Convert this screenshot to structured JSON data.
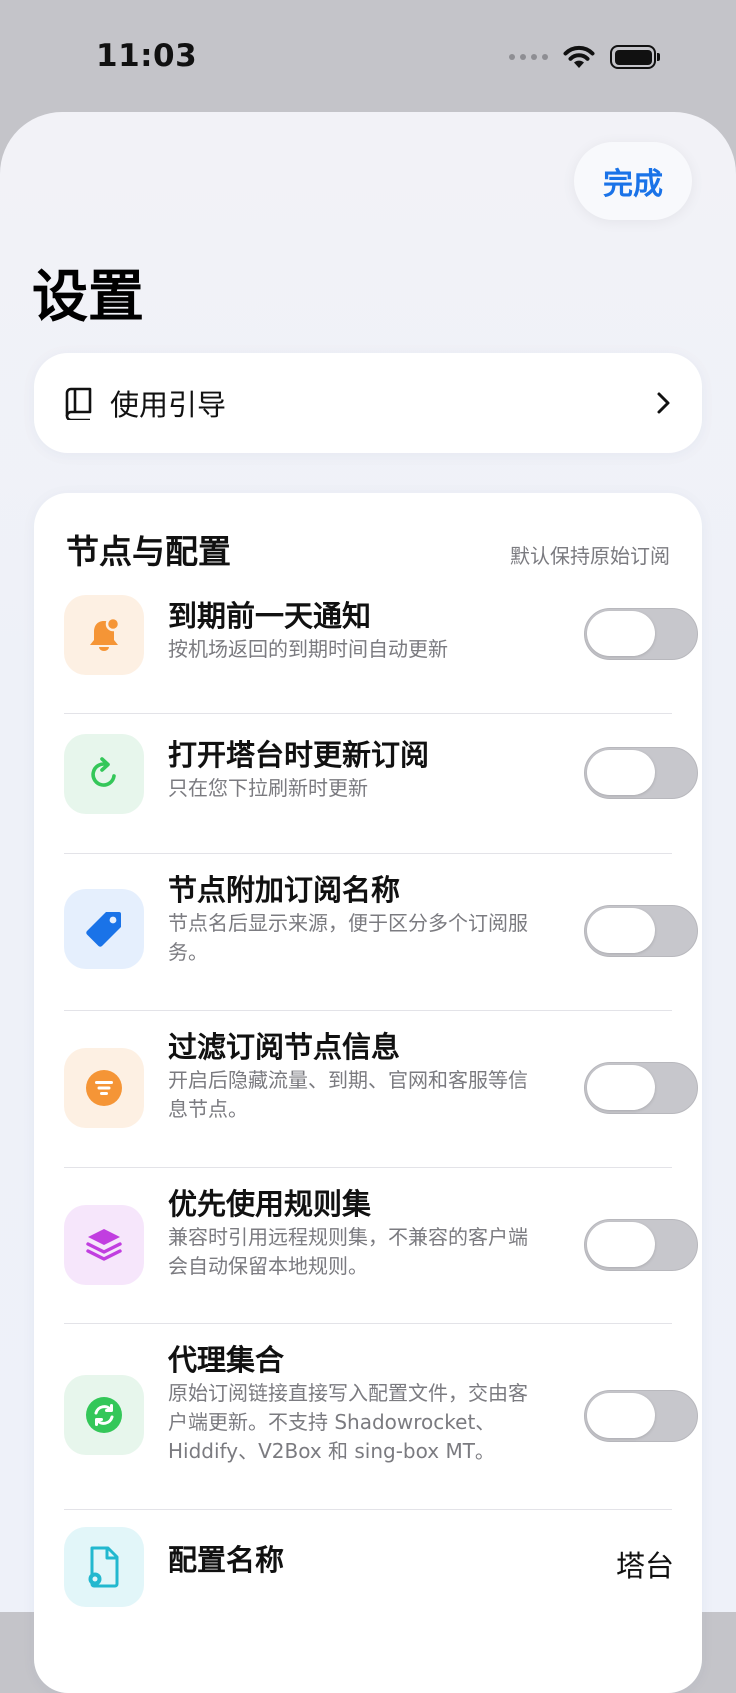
{
  "status": {
    "time": "11:03"
  },
  "header": {
    "done_label": "完成",
    "title": "设置"
  },
  "guide": {
    "label": "使用引导"
  },
  "section": {
    "title": "节点与配置",
    "note": "默认保持原始订阅",
    "rows": [
      {
        "title": "到期前一天通知",
        "subtitle": "按机场返回的到期时间自动更新",
        "icon": "bell-icon",
        "on": false
      },
      {
        "title": "打开塔台时更新订阅",
        "subtitle": "只在您下拉刷新时更新",
        "icon": "refresh-icon",
        "on": false
      },
      {
        "title": "节点附加订阅名称",
        "subtitle": "节点名后显示来源，便于区分多个订阅服务。",
        "icon": "tag-icon",
        "on": false
      },
      {
        "title": "过滤订阅节点信息",
        "subtitle": "开启后隐藏流量、到期、官网和客服等信息节点。",
        "icon": "filter-icon",
        "on": false
      },
      {
        "title": "优先使用规则集",
        "subtitle": "兼容时引用远程规则集，不兼容的客户端会自动保留本地规则。",
        "icon": "layers-icon",
        "on": false
      },
      {
        "title": "代理集合",
        "subtitle": "原始订阅链接直接写入配置文件，交由客户端更新。不支持 Shadowrocket、Hiddify、V2Box 和 sing-box MT。",
        "icon": "sync-icon",
        "on": false
      }
    ],
    "config_name": {
      "title": "配置名称",
      "value": "塔台",
      "icon": "file-gear-icon"
    }
  },
  "colors": {
    "accent": "#1a73e8",
    "toggle_off": "#c7c7cc"
  }
}
